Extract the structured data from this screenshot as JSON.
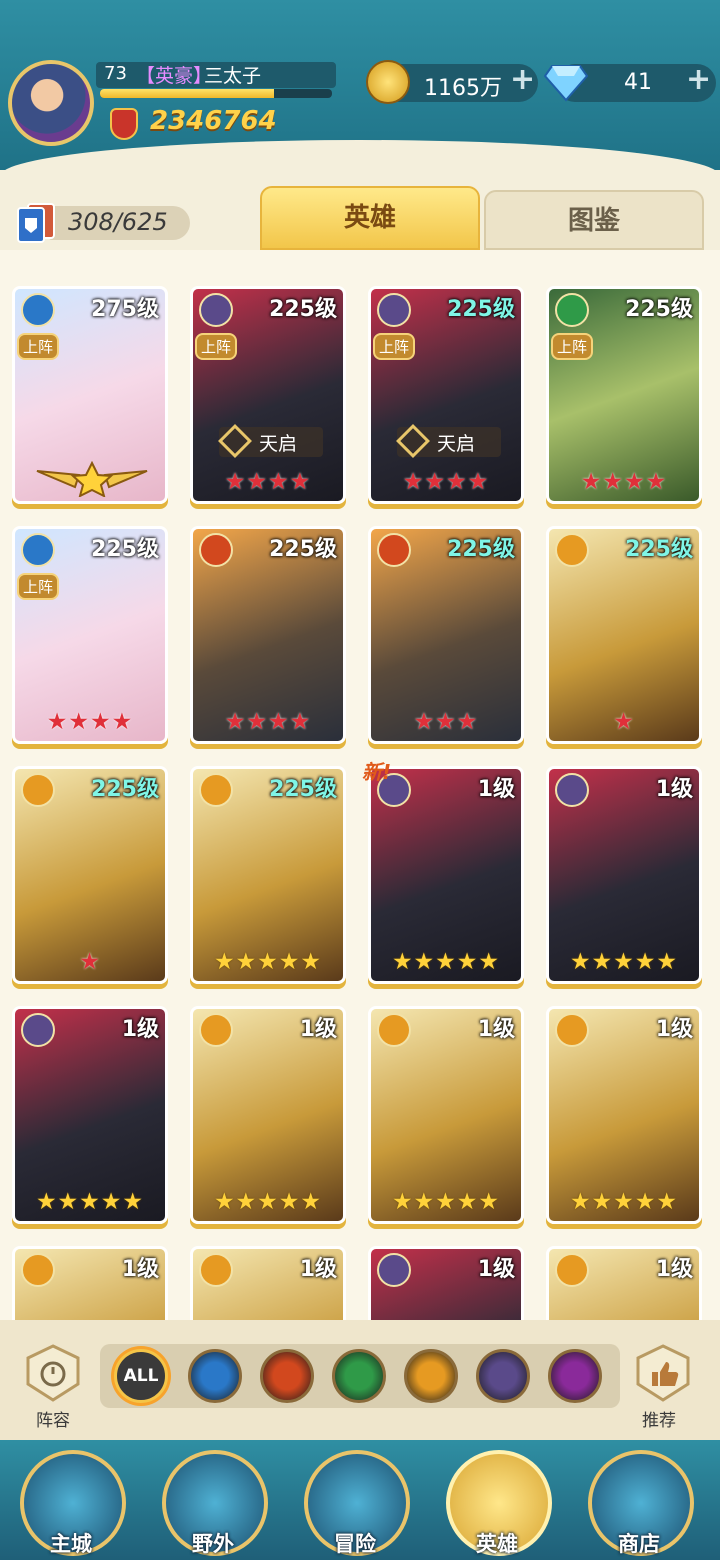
{
  "player": {
    "level": "73",
    "title": "【英豪】",
    "name": "三太子",
    "xp_fraction": 0.75,
    "power": "2346764"
  },
  "resources": {
    "gold": "1165万",
    "gems": "41",
    "plus": "+"
  },
  "collection": "308/625",
  "tabs": [
    {
      "label": "英雄",
      "active": true
    },
    {
      "label": "图鉴",
      "active": false
    }
  ],
  "new_label": "新!",
  "heroes": [
    {
      "level": "275级",
      "element": "water",
      "on_team": "上阵",
      "awakening": "",
      "stars": 0,
      "star_color": "gold",
      "has_wings": true,
      "level_color": "white"
    },
    {
      "level": "225级",
      "element": "dark",
      "on_team": "上阵",
      "awakening": "天启",
      "stars": 4,
      "star_color": "red",
      "level_color": "white"
    },
    {
      "level": "225级",
      "element": "dark",
      "on_team": "上阵",
      "awakening": "天启",
      "stars": 4,
      "star_color": "red",
      "level_color": "cyan"
    },
    {
      "level": "225级",
      "element": "nature",
      "on_team": "上阵",
      "awakening": "",
      "stars": 4,
      "star_color": "red",
      "level_color": "white"
    },
    {
      "level": "225级",
      "element": "water",
      "on_team": "上阵",
      "awakening": "",
      "stars": 4,
      "star_color": "red",
      "level_color": "white"
    },
    {
      "level": "225级",
      "element": "fire",
      "on_team": "",
      "awakening": "",
      "stars": 4,
      "star_color": "red",
      "level_color": "white"
    },
    {
      "level": "225级",
      "element": "fire",
      "on_team": "",
      "awakening": "",
      "stars": 3,
      "star_color": "red",
      "level_color": "cyan"
    },
    {
      "level": "225级",
      "element": "light",
      "on_team": "",
      "awakening": "",
      "stars": 1,
      "star_color": "red",
      "level_color": "cyan"
    },
    {
      "level": "225级",
      "element": "light",
      "on_team": "",
      "awakening": "",
      "stars": 1,
      "star_color": "red",
      "level_color": "cyan"
    },
    {
      "level": "225级",
      "element": "light",
      "on_team": "",
      "awakening": "",
      "stars": 5,
      "star_color": "gold",
      "level_color": "cyan"
    },
    {
      "level": "1级",
      "element": "dark",
      "on_team": "",
      "awakening": "",
      "stars": 5,
      "star_color": "gold",
      "level_color": "white",
      "is_new": true
    },
    {
      "level": "1级",
      "element": "dark",
      "on_team": "",
      "awakening": "",
      "stars": 5,
      "star_color": "gold",
      "level_color": "white"
    },
    {
      "level": "1级",
      "element": "dark",
      "on_team": "",
      "awakening": "",
      "stars": 5,
      "star_color": "gold",
      "level_color": "white"
    },
    {
      "level": "1级",
      "element": "light",
      "on_team": "",
      "awakening": "",
      "stars": 5,
      "star_color": "gold",
      "level_color": "white"
    },
    {
      "level": "1级",
      "element": "light",
      "on_team": "",
      "awakening": "",
      "stars": 5,
      "star_color": "gold",
      "level_color": "white"
    },
    {
      "level": "1级",
      "element": "light",
      "on_team": "",
      "awakening": "",
      "stars": 5,
      "star_color": "gold",
      "level_color": "white"
    },
    {
      "level": "1级",
      "element": "light",
      "on_team": "",
      "awakening": "",
      "stars": 0,
      "star_color": "gold",
      "level_color": "white"
    },
    {
      "level": "1级",
      "element": "light",
      "on_team": "",
      "awakening": "",
      "stars": 0,
      "star_color": "gold",
      "level_color": "white"
    },
    {
      "level": "1级",
      "element": "dark",
      "on_team": "",
      "awakening": "",
      "stars": 0,
      "star_color": "gold",
      "level_color": "white"
    },
    {
      "level": "1级",
      "element": "light",
      "on_team": "",
      "awakening": "",
      "stars": 0,
      "star_color": "gold",
      "level_color": "white"
    }
  ],
  "filters": {
    "lineup_label": "阵容",
    "recommend_label": "推荐",
    "all_label": "ALL",
    "elements": [
      "water",
      "fire",
      "nature",
      "light",
      "dark",
      "arcane"
    ]
  },
  "nav": [
    {
      "label": "主城",
      "active": false
    },
    {
      "label": "野外",
      "active": false
    },
    {
      "label": "冒险",
      "active": false
    },
    {
      "label": "英雄",
      "active": true
    },
    {
      "label": "商店",
      "active": false
    }
  ],
  "element_colors": {
    "water": "#2a78c8",
    "fire": "#d2481e",
    "nature": "#2f9a48",
    "light": "#e69a22",
    "dark": "#5a4a8a",
    "arcane": "#8a2a9a"
  }
}
